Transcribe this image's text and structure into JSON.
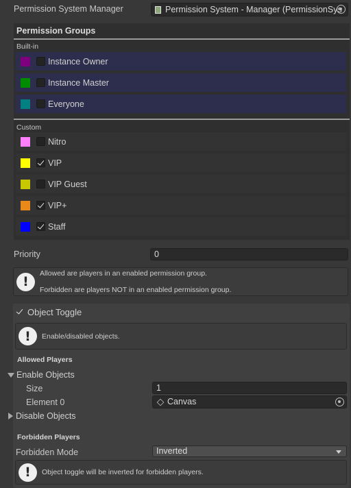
{
  "header": {
    "label": "Permission System Manager",
    "object_value": "Permission System - Manager (PermissionSys"
  },
  "groups": {
    "title": "Permission Groups",
    "builtin_label": "Built-in",
    "builtin": [
      {
        "name": "Instance Owner",
        "color": "#7f007f",
        "checked": false
      },
      {
        "name": "Instance Master",
        "color": "#008c00",
        "checked": false
      },
      {
        "name": "Everyone",
        "color": "#008080",
        "checked": false
      }
    ],
    "custom_label": "Custom",
    "custom": [
      {
        "name": "Nitro",
        "color": "#ff80ff",
        "checked": false
      },
      {
        "name": "VIP",
        "color": "#ffff00",
        "checked": true
      },
      {
        "name": "VIP Guest",
        "color": "#c8c800",
        "checked": false
      },
      {
        "name": "VIP+",
        "color": "#e8891a",
        "checked": true
      },
      {
        "name": "Staff",
        "color": "#0000ff",
        "checked": true
      }
    ]
  },
  "priority": {
    "label": "Priority",
    "value": "0"
  },
  "info_help": {
    "line1": "Allowed are players in an enabled permission group.",
    "line2": "Forbidden are players NOT in an enabled permission group."
  },
  "object_toggle": {
    "label": "Object Toggle",
    "checked": true,
    "help": "Enable/disabled objects.",
    "allowed_heading": "Allowed Players",
    "enable_objects": {
      "label": "Enable Objects",
      "size_label": "Size",
      "size_value": "1",
      "element_label": "Element 0",
      "element_value": "Canvas"
    },
    "disable_objects_label": "Disable Objects",
    "forbidden_heading": "Forbidden Players",
    "forbidden_mode_label": "Forbidden Mode",
    "forbidden_mode_value": "Inverted",
    "forbidden_help": "Object toggle will be inverted for forbidden players."
  }
}
